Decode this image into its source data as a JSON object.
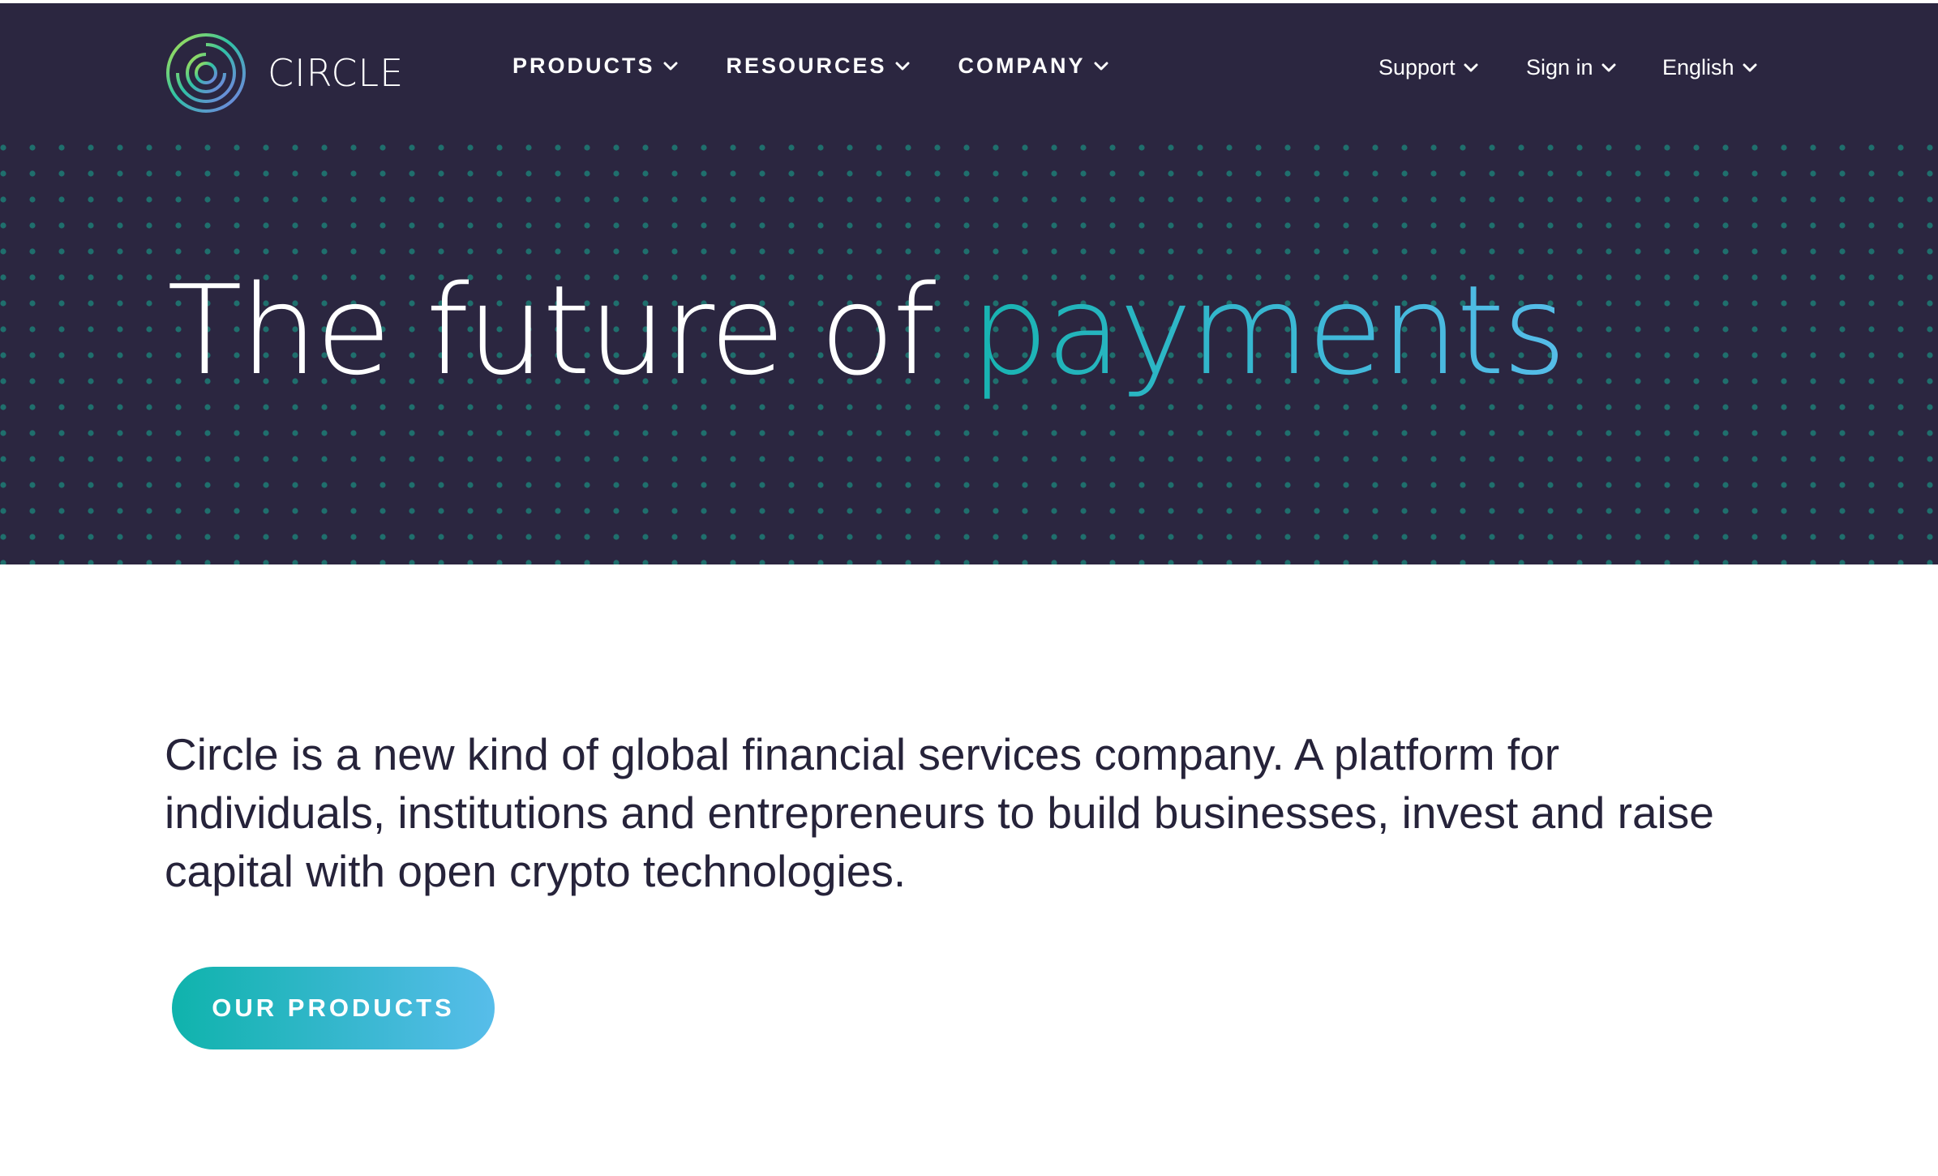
{
  "brand": {
    "name": "CIRCLE",
    "logo_icon": "circle-logo-icon",
    "colors": {
      "hero_background": "#2b2640",
      "accent_start": "#17b3b0",
      "accent_end": "#56bde9",
      "body_text": "#26233a",
      "dot_pattern": "#1f6f6d"
    }
  },
  "nav": {
    "main": [
      {
        "label": "PRODUCTS",
        "icon": "chevron-down-icon"
      },
      {
        "label": "RESOURCES",
        "icon": "chevron-down-icon"
      },
      {
        "label": "COMPANY",
        "icon": "chevron-down-icon"
      }
    ],
    "utility": [
      {
        "label": "Support",
        "icon": "chevron-down-icon"
      },
      {
        "label": "Sign in",
        "icon": "chevron-down-icon"
      },
      {
        "label": "English",
        "icon": "chevron-down-icon"
      }
    ]
  },
  "hero": {
    "headline_prefix": "The future of ",
    "headline_accent": "payments"
  },
  "intro": {
    "text": "Circle is a new kind of global financial services company. A platform for individuals, institutions and entrepreneurs to build businesses, invest and raise capital with open crypto technologies."
  },
  "cta": {
    "label": "OUR PRODUCTS"
  }
}
